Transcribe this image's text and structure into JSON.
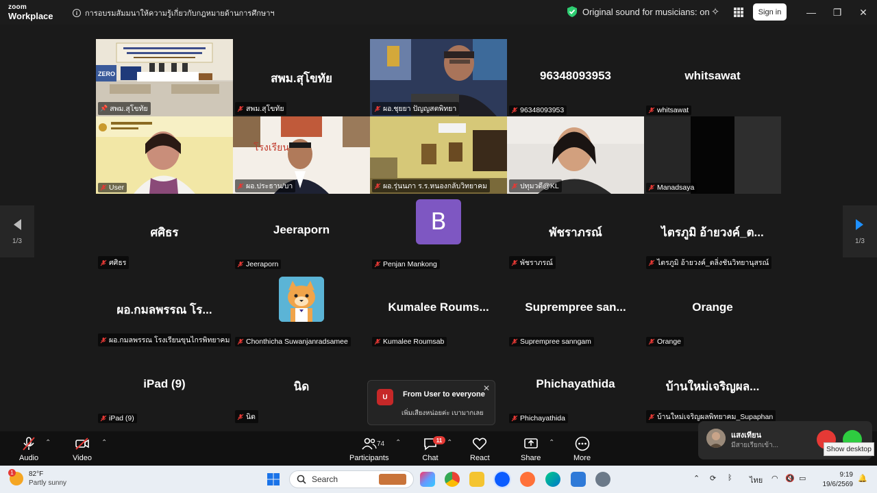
{
  "titlebar": {
    "brand_line1": "zoom",
    "brand_line2": "Workplace",
    "meeting_title": "การอบรมสัมมนาให้ความรู้เกี่ยวกับกฎหมายด้านการศึกษาฯ",
    "sound_status": "Original sound for musicians: on",
    "signin_label": "Sign in"
  },
  "gallery": {
    "page_indicator_left": "1/3",
    "page_indicator_right": "1/3",
    "row1": [
      {
        "big": "",
        "label": "สพม.สุโขทัย",
        "kind": "video-stage",
        "pinned": true
      },
      {
        "big": "สพม.สุโขทัย",
        "label": "สพม.สุโขทัย",
        "kind": "name"
      },
      {
        "big": "",
        "label": "ผอ.ชุยยา ปัญญสตพิทยา",
        "kind": "video-man"
      },
      {
        "big": "96348093953",
        "label": "96348093953",
        "kind": "name"
      },
      {
        "big": "whitsawat",
        "label": "whitsawat",
        "kind": "name"
      }
    ],
    "row2": [
      {
        "big": "",
        "label": "User",
        "kind": "video-woman"
      },
      {
        "big": "",
        "label": "ผอ.ประธาน/บา",
        "kind": "video-man2"
      },
      {
        "big": "",
        "label": "ผอ.รุ่นนภา ร.ร.หนองกลับวิทยาคม",
        "kind": "video-room"
      },
      {
        "big": "",
        "label": "ปทุมวดี@KL",
        "kind": "video-woman2"
      },
      {
        "big": "",
        "label": "Manadsaya",
        "kind": "video-dark"
      }
    ],
    "row3": [
      {
        "big": "ศศิธร",
        "label": "ศศิธร"
      },
      {
        "big": "Jeeraporn",
        "label": "Jeeraporn"
      },
      {
        "big": "",
        "label": "Penjan Mankong",
        "avatar_letter": "B"
      },
      {
        "big": "พัชราภรณ์",
        "label": "พัชราภรณ์"
      },
      {
        "big": "ไตรภูมิ อ้ายวงค์_ต...",
        "label": "ไตรภูมิ อ้ายวงค์_ตลิ่งชันวิทยานุสรณ์"
      }
    ],
    "row4": [
      {
        "big": "ผอ.กมลพรรณ โร...",
        "label": "ผอ.กมลพรรณ โรงเรียนขุนไกรพิทยาคม"
      },
      {
        "big": "",
        "label": "Chonthicha Suwanjanradsamee",
        "avatar": "cat"
      },
      {
        "big": "Kumalee  Roums...",
        "label": "Kumalee Roumsab"
      },
      {
        "big": "Suprempree  san...",
        "label": "Suprempree sanngam"
      },
      {
        "big": "Orange",
        "label": "Orange"
      }
    ],
    "row5": [
      {
        "big": "iPad (9)",
        "label": "iPad (9)"
      },
      {
        "big": "นิด",
        "label": "นิด"
      },
      {
        "big": "",
        "label": ""
      },
      {
        "big": "Phichayathida",
        "label": "Phichayathida"
      },
      {
        "big": "บ้านใหม่เจริญผล...",
        "label": "บ้านใหม่เจริญผลพิทยาคม_Supaphan"
      }
    ]
  },
  "chat_toast": {
    "avatar_letter": "U",
    "title": "From User to everyone",
    "message": "เพิ่มเสียงหน่อยค่ะ เบามากเลย"
  },
  "toolbar": {
    "audio_label": "Audio",
    "video_label": "Video",
    "participants_label": "Participants",
    "participants_count": "74",
    "chat_label": "Chat",
    "chat_badge": "11",
    "react_label": "React",
    "share_label": "Share",
    "more_label": "More"
  },
  "incoming_call": {
    "caller_name": "แสงเทียน",
    "caller_status": "มีสายเรียกเข้า..."
  },
  "tooltip": "Show desktop",
  "taskbar": {
    "temperature": "82°F",
    "weather_desc": "Partly sunny",
    "weather_badge": "1",
    "search_label": "Search",
    "lang": "ไทย",
    "time": "9:19",
    "date": "19/6/2569"
  },
  "colors": {
    "active_speaker": "#2ecc71",
    "muted_red": "#e53935",
    "avatar_purple": "#7e57c2",
    "nav_arrow_blue": "#1e90ff"
  }
}
